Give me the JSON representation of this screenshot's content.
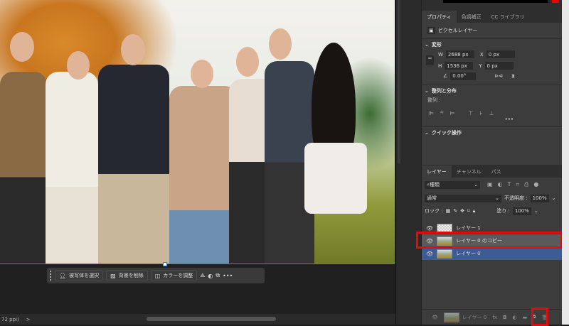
{
  "canvas": {
    "status_text": "72 ppi)",
    "status_arrow": ">"
  },
  "context_bar": {
    "select_subject": "被写体を選択",
    "remove_bg": "背景を削除",
    "adjust_color": "カラーを調整",
    "more": "•••"
  },
  "properties": {
    "tabs": [
      "プロパティ",
      "色調補正",
      "CC ライブラリ"
    ],
    "layer_type": "ピクセルレイヤー",
    "transform": {
      "title": "変形",
      "w_label": "W",
      "w": "2688 px",
      "h_label": "H",
      "h": "1536 px",
      "x_label": "X",
      "x": "0 px",
      "y_label": "Y",
      "y": "0 px",
      "angle": "0.00°"
    },
    "align": {
      "title": "整列と分布",
      "label": "整列 :",
      "more": "•••"
    },
    "quick": {
      "title": "クイック操作"
    }
  },
  "layers": {
    "tabs": [
      "レイヤー",
      "チャンネル",
      "パス"
    ],
    "filter": "種類",
    "blend_mode": "通常",
    "opacity_label": "不透明度 :",
    "opacity": "100%",
    "lock_label": "ロック :",
    "fill_label": "塗り :",
    "fill": "100%",
    "items": [
      {
        "name": "レイヤー 1",
        "state": "normal"
      },
      {
        "name": "レイヤー 0 のコピー",
        "state": "highlighted"
      },
      {
        "name": "レイヤー 0",
        "state": "selected"
      }
    ],
    "footer_layer": "レイヤー 0",
    "fx": "fx"
  }
}
